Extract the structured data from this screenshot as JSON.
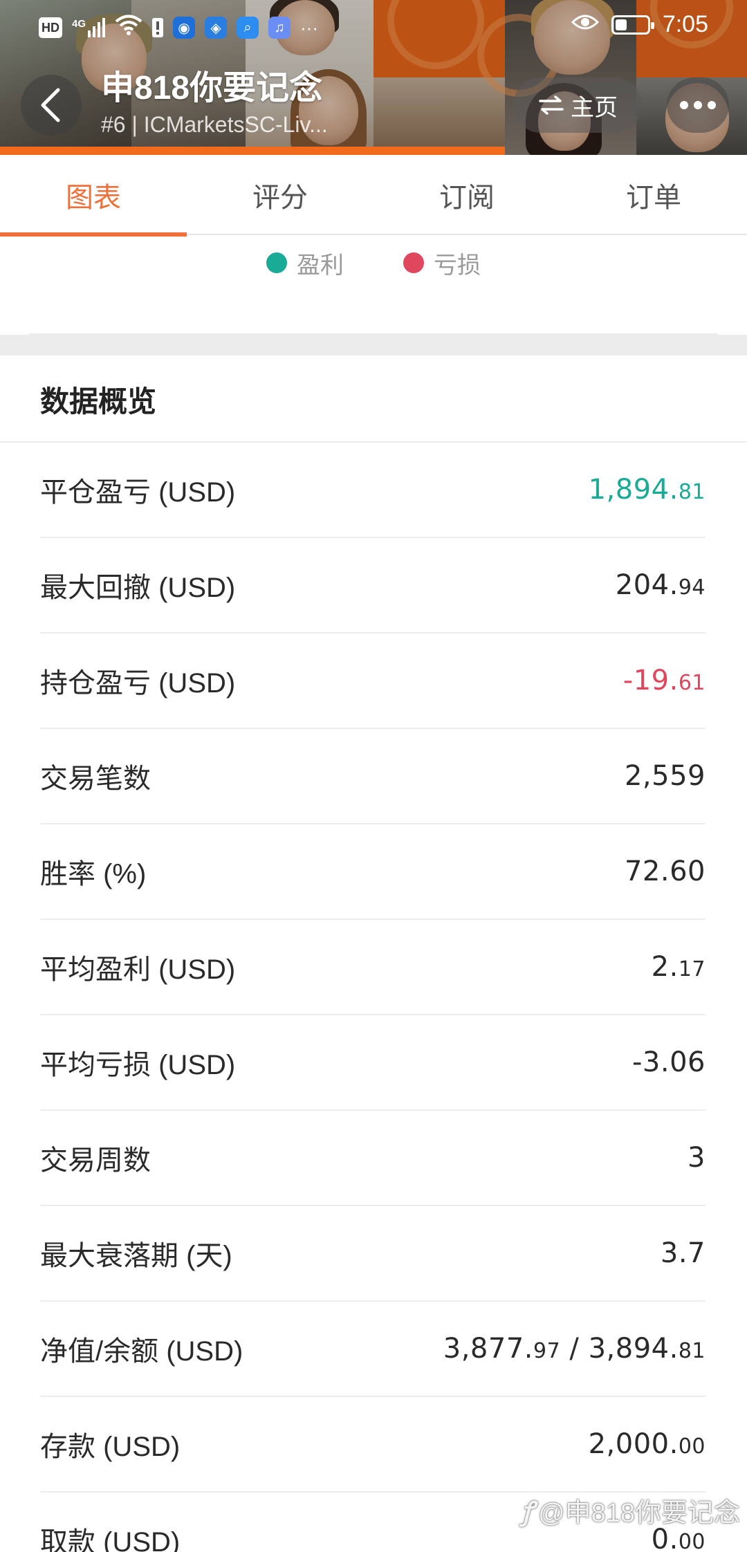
{
  "status_bar": {
    "network_badge": "HD",
    "signal_label": "4G",
    "time": "7:05",
    "more_indicator": "···"
  },
  "header": {
    "title": "申818你要记念",
    "subtitle": "#6 | ICMarketsSC-Liv...",
    "home_label": "主页"
  },
  "tabs": [
    {
      "label": "图表",
      "active": true
    },
    {
      "label": "评分",
      "active": false
    },
    {
      "label": "订阅",
      "active": false
    },
    {
      "label": "订单",
      "active": false
    }
  ],
  "legend": [
    {
      "label": "盈利",
      "color": "#1aab96"
    },
    {
      "label": "亏损",
      "color": "#e0475f"
    }
  ],
  "overview": {
    "title": "数据概览",
    "rows": [
      {
        "label": "平仓盈亏 (USD)",
        "value_main": "1,894.",
        "value_small": "81",
        "tone": "green"
      },
      {
        "label": "最大回撤 (USD)",
        "value_main": "204.",
        "value_small": "94",
        "tone": "normal"
      },
      {
        "label": "持仓盈亏 (USD)",
        "value_main": "-19.",
        "value_small": "61",
        "tone": "red"
      },
      {
        "label": "交易笔数",
        "value_main": "2,559",
        "value_small": "",
        "tone": "normal"
      },
      {
        "label": "胜率 (%)",
        "value_main": "72.60",
        "value_small": "",
        "tone": "normal"
      },
      {
        "label": "平均盈利 (USD)",
        "value_main": "2.",
        "value_small": "17",
        "tone": "normal"
      },
      {
        "label": "平均亏损 (USD)",
        "value_main": "-3.06",
        "value_small": "",
        "tone": "normal"
      },
      {
        "label": "交易周数",
        "value_main": "3",
        "value_small": "",
        "tone": "normal"
      },
      {
        "label": "最大衰落期 (天)",
        "value_main": "3.7",
        "value_small": "",
        "tone": "normal"
      },
      {
        "label": "净值/余额 (USD)",
        "value_main": "3,877.",
        "value_small": "97",
        "value_main2": " / 3,894.",
        "value_small2": "81",
        "tone": "normal"
      },
      {
        "label": "存款 (USD)",
        "value_main": "2,000.",
        "value_small": "00",
        "tone": "normal"
      },
      {
        "label": "取款 (USD)",
        "value_main": "0.",
        "value_small": "00",
        "tone": "normal"
      }
    ]
  },
  "watermark": "@申818你要记念",
  "colors": {
    "accent": "#f0703a",
    "profit": "#1aab96",
    "loss": "#e0475f"
  }
}
